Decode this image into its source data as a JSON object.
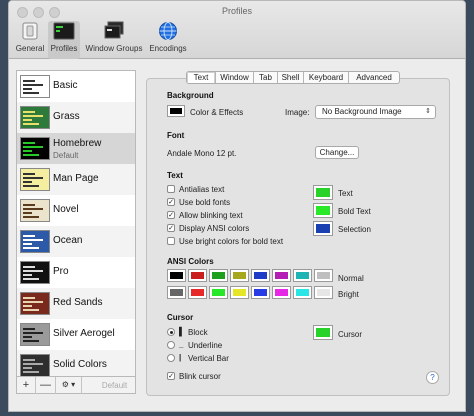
{
  "window": {
    "title": "Profiles"
  },
  "toolbar": [
    {
      "label": "General",
      "icon": "general-icon"
    },
    {
      "label": "Profiles",
      "icon": "profiles-icon",
      "selected": true
    },
    {
      "label": "Window Groups",
      "icon": "window-groups-icon"
    },
    {
      "label": "Encodings",
      "icon": "globe-icon"
    }
  ],
  "profiles": [
    {
      "name": "Basic",
      "bg": "#ffffff",
      "fg": "#333333"
    },
    {
      "name": "Grass",
      "bg": "#2d7a3a",
      "fg": "#e8e06a"
    },
    {
      "name": "Homebrew",
      "bg": "#000000",
      "fg": "#28c828",
      "subtitle": "Default",
      "selected": true
    },
    {
      "name": "Man Page",
      "bg": "#f5eda0",
      "fg": "#333333"
    },
    {
      "name": "Novel",
      "bg": "#ece3cc",
      "fg": "#5a3b1e"
    },
    {
      "name": "Ocean",
      "bg": "#2c5aa8",
      "fg": "#ffffff"
    },
    {
      "name": "Pro",
      "bg": "#111111",
      "fg": "#dddddd"
    },
    {
      "name": "Red Sands",
      "bg": "#7a2a1c",
      "fg": "#e8d5b0"
    },
    {
      "name": "Silver Aerogel",
      "bg": "#9a9a9a",
      "fg": "#222222"
    },
    {
      "name": "Solid Colors",
      "bg": "#2e2e2e",
      "fg": "#aaaaaa"
    }
  ],
  "sidebar_bar": {
    "add": "+",
    "remove": "—",
    "gear": "⚙ ▾",
    "default": "Default"
  },
  "tabs": [
    "Text",
    "Window",
    "Tab",
    "Shell",
    "Keyboard",
    "Advanced"
  ],
  "background": {
    "heading": "Background",
    "color_label": "Color & Effects",
    "image_label": "Image:",
    "image_value": "No Background Image",
    "color": "#000000"
  },
  "font": {
    "heading": "Font",
    "value": "Andale Mono 12 pt.",
    "button": "Change..."
  },
  "text": {
    "heading": "Text",
    "options": [
      {
        "label": "Antialias text",
        "checked": false
      },
      {
        "label": "Use bold fonts",
        "checked": true
      },
      {
        "label": "Allow blinking text",
        "checked": true
      },
      {
        "label": "Display ANSI colors",
        "checked": true
      },
      {
        "label": "Use bright colors for bold text",
        "checked": false
      }
    ],
    "colors": [
      {
        "label": "Text",
        "color": "#28d228"
      },
      {
        "label": "Bold Text",
        "color": "#28e828"
      },
      {
        "label": "Selection",
        "color": "#1a3fb0"
      }
    ]
  },
  "ansi": {
    "heading": "ANSI Colors",
    "normal_label": "Normal",
    "bright_label": "Bright",
    "normal": [
      "#000000",
      "#c81e1e",
      "#1ea01e",
      "#a8a81e",
      "#1e3cc8",
      "#b41eb4",
      "#1eb4b4",
      "#bfbfbf"
    ],
    "bright": [
      "#666666",
      "#e62828",
      "#28e628",
      "#e6e628",
      "#283ce6",
      "#e628e6",
      "#28e6e6",
      "#e6e6e6"
    ]
  },
  "cursor": {
    "heading": "Cursor",
    "options": [
      {
        "label": "Block",
        "glyph": "▌",
        "selected": true
      },
      {
        "label": "Underline",
        "glyph": "_",
        "selected": false
      },
      {
        "label": "Vertical Bar",
        "glyph": "|",
        "selected": false
      }
    ],
    "color_label": "Cursor",
    "color": "#28d228",
    "blink_label": "Blink cursor",
    "blink_checked": true
  },
  "help": "?"
}
